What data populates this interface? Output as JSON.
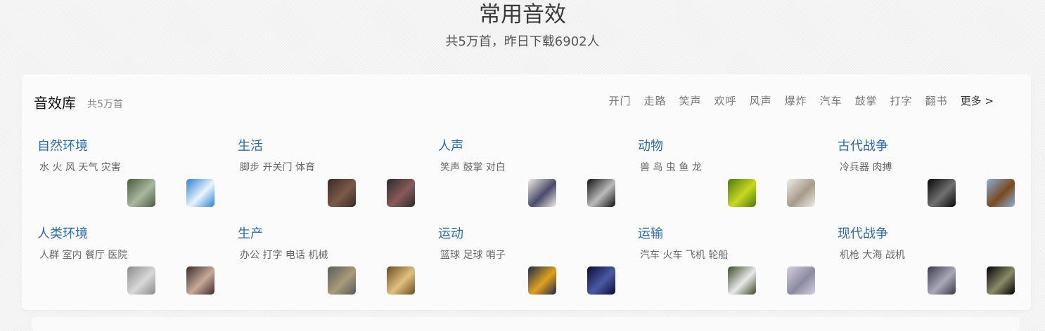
{
  "header": {
    "title": "常用音效",
    "subtitle": "共5万首，昨日下载6902人"
  },
  "library": {
    "title": "音效库",
    "count": "共5万首",
    "tags": [
      "开门",
      "走路",
      "笑声",
      "欢呼",
      "风声",
      "爆炸",
      "汽车",
      "鼓掌",
      "打字",
      "翻书"
    ],
    "more": "更多 >"
  },
  "categories": [
    {
      "name": "自然环境",
      "sub": "水 火 风 天气 灾害",
      "thumbs": [
        "forest-path-image",
        "sunny-beach-image"
      ],
      "colors": [
        [
          "#4a5a3a",
          "#a8b8a0"
        ],
        [
          "#2a7fd0",
          "#e8f4ff"
        ]
      ]
    },
    {
      "name": "生活",
      "sub": "脚步 开关门 体育",
      "thumbs": [
        "feet-image",
        "motorcycle-image"
      ],
      "colors": [
        [
          "#3a2a24",
          "#7a5a4a"
        ],
        [
          "#2a2a2a",
          "#8a5a5a"
        ]
      ]
    },
    {
      "name": "人声",
      "sub": "笑声 鼓掌 对白",
      "thumbs": [
        "person-image",
        "cheering-silhouette-image"
      ],
      "colors": [
        [
          "#f2ece6",
          "#4a4a6a"
        ],
        [
          "#111111",
          "#bbbbbb"
        ]
      ]
    },
    {
      "name": "动物",
      "sub": "兽 鸟 虫 鱼 龙",
      "thumbs": [
        "ladybug-image",
        "hummingbird-image"
      ],
      "colors": [
        [
          "#4a7a10",
          "#c8d820"
        ],
        [
          "#f0ece6",
          "#a89a8a"
        ]
      ]
    },
    {
      "name": "古代战争",
      "sub": "冷兵器 肉搏",
      "thumbs": [
        "sword-image",
        "horse-rider-image"
      ],
      "colors": [
        [
          "#050505",
          "#707070"
        ],
        [
          "#8ab0d8",
          "#7a4a20"
        ]
      ]
    },
    {
      "name": "人类环境",
      "sub": "人群 室内 餐厅 医院",
      "thumbs": [
        "interior-image",
        "crowd-image"
      ],
      "colors": [
        [
          "#8a8a8a",
          "#d8d8d8"
        ],
        [
          "#3a2a2a",
          "#c8a89a"
        ]
      ]
    },
    {
      "name": "生产",
      "sub": "办公 打字 电话 机械",
      "thumbs": [
        "machinery-image",
        "food-market-image"
      ],
      "colors": [
        [
          "#5a5a5a",
          "#a89a7a"
        ],
        [
          "#6a4a20",
          "#e0c080"
        ]
      ]
    },
    {
      "name": "运动",
      "sub": "篮球 足球 哨子",
      "thumbs": [
        "sunset-rider-image",
        "runners-image"
      ],
      "colors": [
        [
          "#1a2a4a",
          "#e0a020"
        ],
        [
          "#0a0a3a",
          "#4a5aa0"
        ]
      ]
    },
    {
      "name": "运输",
      "sub": "汽车 火车 飞机 轮船",
      "thumbs": [
        "train-image",
        "airplane-image"
      ],
      "colors": [
        [
          "#3a4a2a",
          "#e8e8e8"
        ],
        [
          "#d8d0e0",
          "#8a8aa0"
        ]
      ]
    },
    {
      "name": "现代战争",
      "sub": "机枪 大海 战机",
      "thumbs": [
        "fighter-jet-image",
        "tank-image"
      ],
      "colors": [
        [
          "#3a3a4a",
          "#a8a8b8"
        ],
        [
          "#000000",
          "#8a8a6a"
        ]
      ]
    }
  ]
}
